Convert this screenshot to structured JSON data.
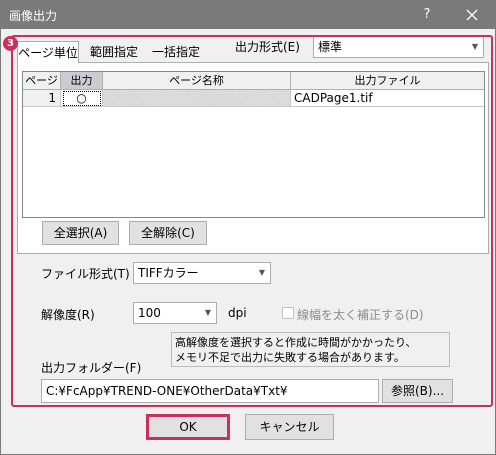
{
  "window": {
    "title": "画像出力",
    "help_label": "?"
  },
  "tabs": [
    {
      "label": "ページ単位",
      "selected": true
    },
    {
      "label": "範囲指定",
      "selected": false
    },
    {
      "label": "一括指定",
      "selected": false
    }
  ],
  "badge": "3",
  "output_format": {
    "label": "出力形式(E)",
    "value": "標準"
  },
  "table": {
    "columns": [
      "ページ",
      "出力",
      "ページ名称",
      "出力ファイル"
    ],
    "rows": [
      {
        "page": "1",
        "output": "○",
        "name": "",
        "file": "CADPage1.tif"
      }
    ]
  },
  "buttons": {
    "select_all": "全選択(A)",
    "deselect_all": "全解除(C)",
    "browse": "参照(B)...",
    "ok": "OK",
    "cancel": "キャンセル"
  },
  "file_format": {
    "label": "ファイル形式(T)",
    "value": "TIFFカラー"
  },
  "resolution": {
    "label": "解像度(R)",
    "value": "100",
    "unit": "dpi"
  },
  "line_correction": {
    "label": "線幅を太く補正する(D)",
    "checked": false,
    "enabled": false
  },
  "note": {
    "line1": "高解像度を選択すると作成に時間がかかったり、",
    "line2": "メモリ不足で出力に失敗する場合があります。"
  },
  "output_folder": {
    "label": "出力フォルダー(F)",
    "value": "C:¥FcApp¥TREND-ONE¥OtherData¥Txt¥"
  },
  "colors": {
    "title_bar": "#7a7a7a",
    "highlight": "#c8325a",
    "window_bg": "#f0f0f0"
  }
}
